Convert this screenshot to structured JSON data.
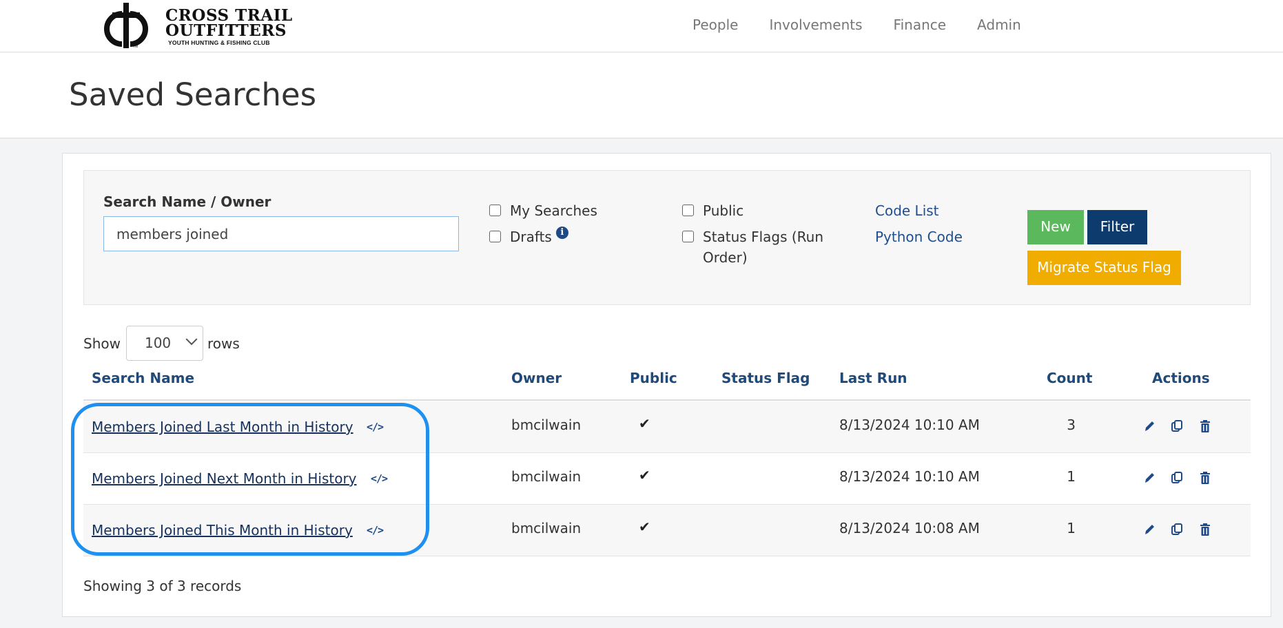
{
  "brand": {
    "line1": "CROSS TRAIL",
    "line2": "OUTFITTERS",
    "line3": "YOUTH HUNTING & FISHING CLUB",
    "icon": "cross-trail-logo-icon"
  },
  "nav": {
    "items": [
      {
        "label": "People"
      },
      {
        "label": "Involvements"
      },
      {
        "label": "Finance"
      },
      {
        "label": "Admin"
      }
    ]
  },
  "page": {
    "title": "Saved Searches"
  },
  "filter": {
    "search_label": "Search Name / Owner",
    "search_value": "members joined",
    "checkboxes": {
      "my_searches": {
        "label": "My Searches",
        "checked": false
      },
      "drafts": {
        "label": "Drafts",
        "checked": false
      },
      "public": {
        "label": "Public",
        "checked": false
      },
      "status_flags": {
        "label": "Status Flags (Run Order)",
        "checked": false
      }
    },
    "links": {
      "code_list": "Code List",
      "python_code": "Python Code"
    },
    "buttons": {
      "new": "New",
      "filter": "Filter",
      "migrate": "Migrate Status Flag"
    }
  },
  "paging": {
    "show_label": "Show",
    "rows_value": "100",
    "rows_label": "rows"
  },
  "table": {
    "headers": {
      "search_name": "Search Name",
      "owner": "Owner",
      "public": "Public",
      "status_flag": "Status Flag",
      "last_run": "Last Run",
      "count": "Count",
      "actions": "Actions"
    },
    "rows": [
      {
        "name": "Members Joined Last Month in History",
        "owner": "bmcilwain",
        "public": "✔",
        "status_flag": "",
        "last_run": "8/13/2024 10:10 AM",
        "count": "3"
      },
      {
        "name": "Members Joined Next Month in History",
        "owner": "bmcilwain",
        "public": "✔",
        "status_flag": "",
        "last_run": "8/13/2024 10:10 AM",
        "count": "1"
      },
      {
        "name": "Members Joined This Month in History",
        "owner": "bmcilwain",
        "public": "✔",
        "status_flag": "",
        "last_run": "8/13/2024 10:08 AM",
        "count": "1"
      }
    ],
    "code_icon": "</>"
  },
  "footer": {
    "showing": "Showing 3 of 3 records"
  },
  "colors": {
    "link": "#16325c",
    "header_text": "#1f4a7a",
    "new_button": "#5cb85c",
    "filter_button": "#0d3b6e",
    "migrate_button": "#f0ad00",
    "highlight": "#1e90f0"
  }
}
